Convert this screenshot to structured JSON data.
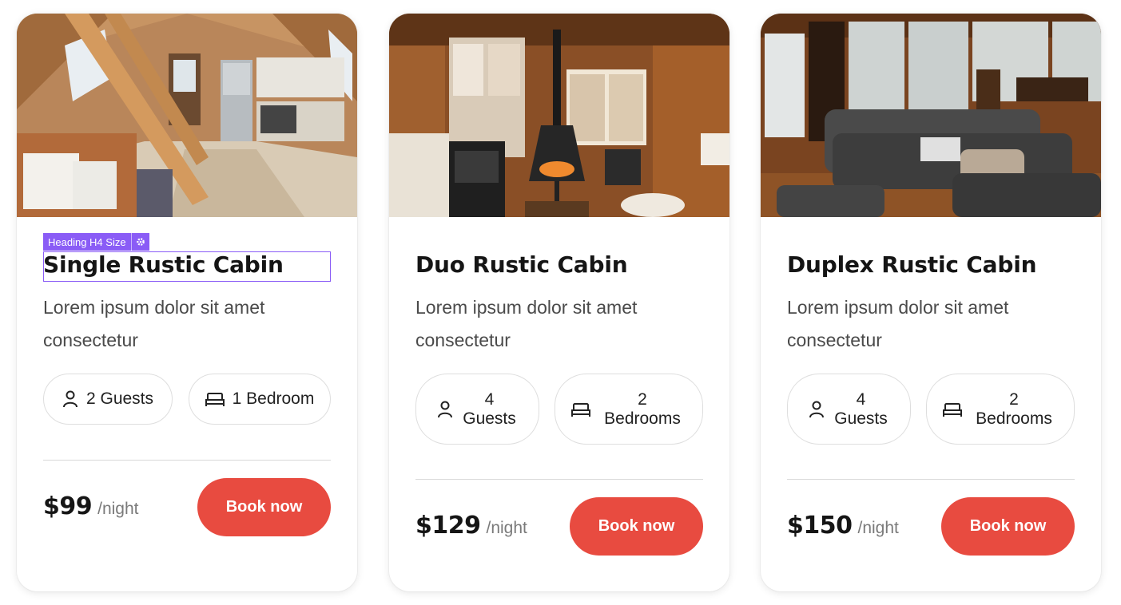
{
  "editor_badge": {
    "label": "Heading H4 Size"
  },
  "cards": [
    {
      "title": "Single Rustic Cabin",
      "description": "Lorem ipsum dolor sit amet consectetur",
      "guests": "2 Guests",
      "bedrooms": "1 Bedroom",
      "price": "$99",
      "per": "/night",
      "button": "Book now"
    },
    {
      "title": "Duo Rustic Cabin",
      "description": "Lorem ipsum dolor sit amet consectetur",
      "guests": "4 Guests",
      "bedrooms": "2 Bedrooms",
      "price": "$129",
      "per": "/night",
      "button": "Book now"
    },
    {
      "title": "Duplex Rustic Cabin",
      "description": "Lorem ipsum dolor sit amet consectetur",
      "guests": "4 Guests",
      "bedrooms": "2 Bedrooms",
      "price": "$150",
      "per": "/night",
      "button": "Book now"
    }
  ],
  "colors": {
    "accent": "#e84b40",
    "editor": "#8a5cf6"
  },
  "icons": {
    "guests": "person-icon",
    "bedrooms": "bed-icon",
    "editor": "gear-icon"
  }
}
